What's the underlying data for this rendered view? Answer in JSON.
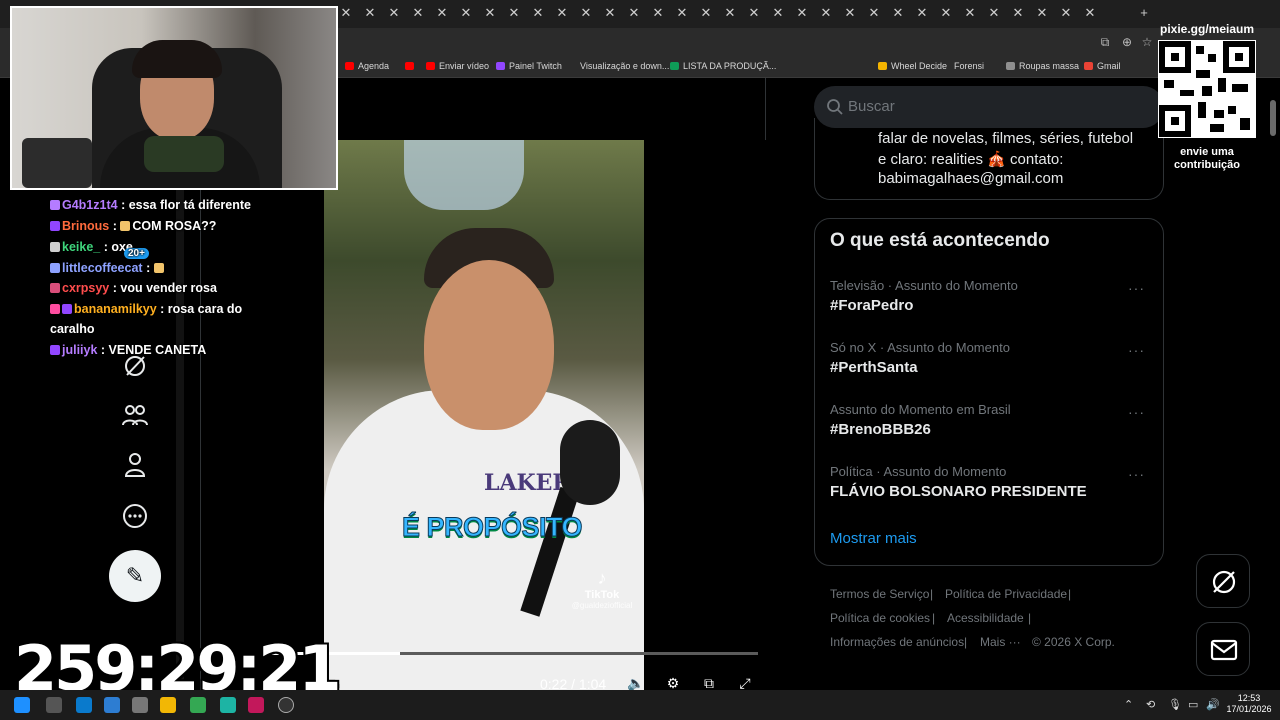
{
  "browser": {
    "bookmarks": [
      {
        "label": "Agenda",
        "color": "#ff0000"
      },
      {
        "label": "",
        "color": "#ff0000"
      },
      {
        "label": "Enviar vídeo",
        "color": "#ff0000"
      },
      {
        "label": "Painel Twitch",
        "color": "#9146ff"
      },
      {
        "label": "Visualização e down...",
        "color": "#2b2b2b"
      },
      {
        "label": "LISTA DA PRODUÇÃ...",
        "color": "#0f9d58"
      },
      {
        "label": "Wheel Decide",
        "color": "#f4b400"
      },
      {
        "label": "Forensi",
        "color": "#2b2b2b"
      },
      {
        "label": "Roupas massa",
        "color": "#8f8f8f"
      },
      {
        "label": "Gmail",
        "color": "#ea4335"
      }
    ]
  },
  "overlay": {
    "qr_title": "pixie.gg/meiaum",
    "qr_subtitle_1": "envie uma",
    "qr_subtitle_2": "contribuição",
    "timer": "259:29:21",
    "chat": [
      {
        "user": "G4b1z1t4",
        "color": "#b57cff",
        "message": "essa flor tá diferente"
      },
      {
        "user": "Brinous",
        "color": "#ff6b3d",
        "message": "COM ROSA??"
      },
      {
        "user": "keike_",
        "color": "#3ed47b",
        "message": "oxe"
      },
      {
        "user": "littlecoffeecat",
        "color": "#8ea2ff",
        "message": ""
      },
      {
        "user": "cxrpsyy",
        "color": "#ff4d4d",
        "message": "vou vender rosa"
      },
      {
        "user": "bananamilkyy",
        "color": "#ffb020",
        "message": "rosa cara do"
      },
      {
        "user": "",
        "color": "#ffffff",
        "message": "caralho"
      },
      {
        "user": "juliiyk",
        "color": "#b57cff",
        "message": "VENDE CANETA"
      }
    ],
    "badge_count": "20+"
  },
  "video": {
    "caption": "É PROPÓSITO",
    "brand_text": "LAKERS",
    "watermark": "TikTok",
    "watermark_handle": "@gualdeziofficial",
    "current_time": "0:22 / 1:04",
    "progress_fraction": 0.27
  },
  "sidebar": {
    "search_placeholder": "Buscar",
    "bio": [
      "falar de novelas, filmes, séries, futebol",
      "e claro: realities 🎪 contato:",
      "babimagalhaes@gmail.com"
    ],
    "trending_title": "O que está acontecendo",
    "trends": [
      {
        "context": "Televisão · Assunto do Momento",
        "name": "#ForaPedro"
      },
      {
        "context": "Só no X · Assunto do Momento",
        "name": "#PerthSanta"
      },
      {
        "context": "Assunto do Momento em Brasil",
        "name": "#BrenoBBB26"
      },
      {
        "context": "Política · Assunto do Momento",
        "name": "FLÁVIO BOLSONARO PRESIDENTE"
      }
    ],
    "show_more": "Mostrar mais",
    "footer": {
      "terms": "Termos de Serviço",
      "privacy": "Política de Privacidade",
      "cookies": "Política de cookies",
      "accessibility": "Acessibilidade",
      "ads": "Informações de anúncios",
      "more": "Mais ···",
      "copyright": "© 2026 X Corp."
    }
  },
  "taskbar": {
    "time": "12:53",
    "date": "17/01/2026"
  }
}
